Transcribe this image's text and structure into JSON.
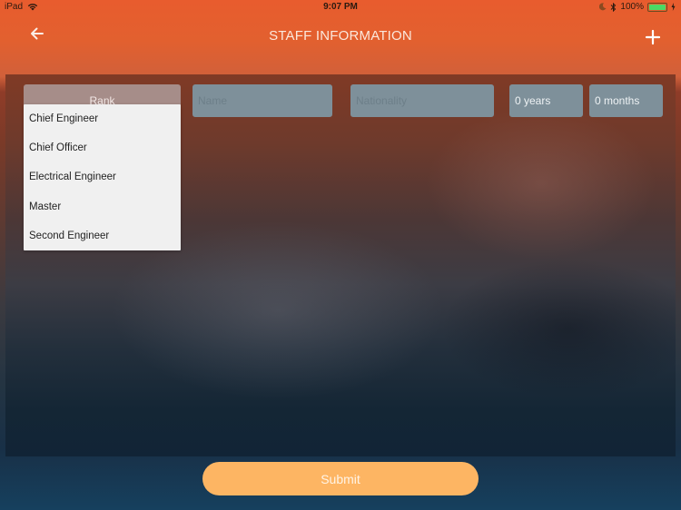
{
  "status_bar": {
    "device": "iPad",
    "time": "9:07 PM",
    "battery_percent": "100%",
    "battery_level": 1.0
  },
  "header": {
    "title": "STAFF INFORMATION",
    "back_icon": "arrow-left-icon",
    "add_icon": "plus-icon"
  },
  "form": {
    "rank": {
      "placeholder": "Rank",
      "options": [
        "Chief Engineer",
        "Chief Officer",
        "Electrical Engineer",
        "Master",
        "Second Engineer"
      ]
    },
    "name": {
      "placeholder": "Name",
      "value": ""
    },
    "nationality": {
      "placeholder": "Nationality",
      "value": ""
    },
    "years": {
      "value": "0 years"
    },
    "months": {
      "value": "0 months"
    }
  },
  "submit_label": "Submit",
  "colors": {
    "header_orange": "#e85c2e",
    "submit_button": "#fdb563",
    "field_bg": "#7e909a",
    "dropdown_bg": "#f0f0f0",
    "battery_green": "#4cd964"
  }
}
